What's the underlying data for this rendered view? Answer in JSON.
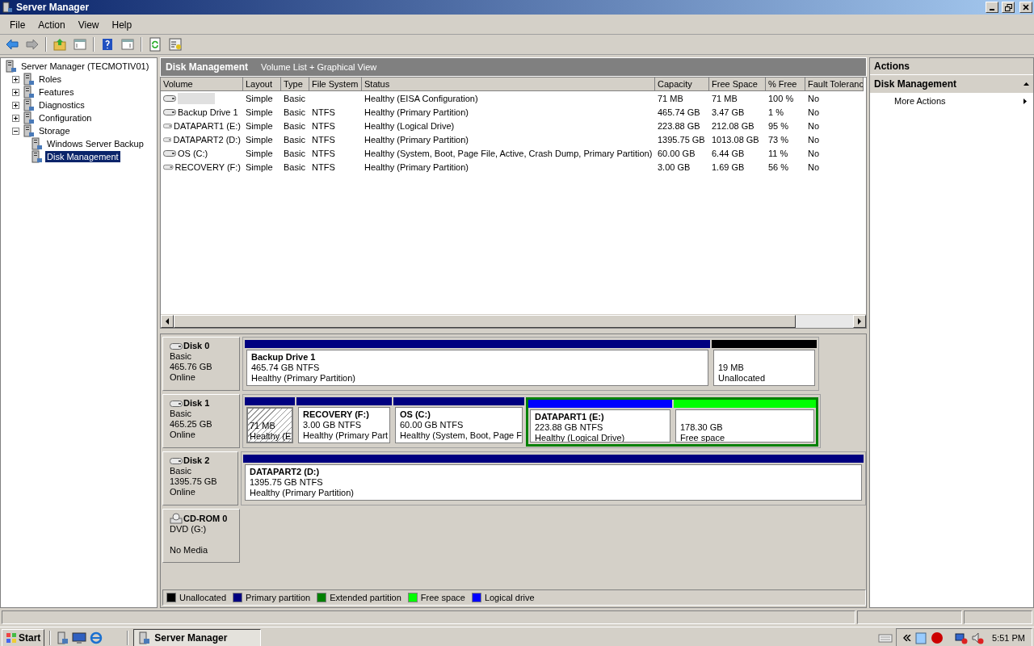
{
  "window": {
    "title": "Server Manager"
  },
  "menu": [
    "File",
    "Action",
    "View",
    "Help"
  ],
  "tree": {
    "label": "Server Manager (TECMOTIV01)",
    "selected": false,
    "children": [
      {
        "label": "Roles",
        "selected": false,
        "expanded": false
      },
      {
        "label": "Features",
        "selected": false,
        "expanded": false
      },
      {
        "label": "Diagnostics",
        "selected": false,
        "expanded": false
      },
      {
        "label": "Configuration",
        "selected": false,
        "expanded": false
      },
      {
        "label": "Storage",
        "selected": false,
        "expanded": true,
        "children": [
          {
            "label": "Windows Server Backup",
            "selected": false
          },
          {
            "label": "Disk Management",
            "selected": true
          }
        ]
      }
    ]
  },
  "center": {
    "title": "Disk Management",
    "subtitle": "Volume List + Graphical View"
  },
  "table": {
    "columns": [
      "Volume",
      "Layout",
      "Type",
      "File System",
      "Status",
      "Capacity",
      "Free Space",
      "% Free",
      "Fault Toleranc"
    ],
    "rows": [
      {
        "redacted": true,
        "cells": [
          "",
          "Simple",
          "Basic",
          "",
          "Healthy (EISA Configuration)",
          "71 MB",
          "71 MB",
          "100 %",
          "No"
        ]
      },
      {
        "cells": [
          "Backup Drive 1",
          "Simple",
          "Basic",
          "NTFS",
          "Healthy (Primary Partition)",
          "465.74 GB",
          "3.47 GB",
          "1 %",
          "No"
        ]
      },
      {
        "cells": [
          "DATAPART1 (E:)",
          "Simple",
          "Basic",
          "NTFS",
          "Healthy (Logical Drive)",
          "223.88 GB",
          "212.08 GB",
          "95 %",
          "No"
        ]
      },
      {
        "cells": [
          "DATAPART2 (D:)",
          "Simple",
          "Basic",
          "NTFS",
          "Healthy (Primary Partition)",
          "1395.75 GB",
          "1013.08 GB",
          "73 %",
          "No"
        ]
      },
      {
        "cells": [
          "OS (C:)",
          "Simple",
          "Basic",
          "NTFS",
          "Healthy (System, Boot, Page File, Active, Crash Dump, Primary Partition)",
          "60.00 GB",
          "6.44 GB",
          "11 %",
          "No"
        ]
      },
      {
        "cells": [
          "RECOVERY (F:)",
          "Simple",
          "Basic",
          "NTFS",
          "Healthy (Primary Partition)",
          "3.00 GB",
          "1.69 GB",
          "56 %",
          "No"
        ]
      }
    ]
  },
  "disks": [
    {
      "kind": "disk",
      "name": "Disk 0",
      "lines": [
        "Basic",
        "465.76 GB",
        "Online"
      ],
      "partitions": [
        {
          "kind": "primary",
          "color": "#000080",
          "name": "Backup Drive 1",
          "lines": [
            "465.74 GB NTFS",
            "Healthy (Primary Partition)"
          ]
        },
        {
          "kind": "unallocated",
          "color": "#000000",
          "lines": [
            "19 MB",
            "Unallocated"
          ]
        }
      ]
    },
    {
      "kind": "disk",
      "name": "Disk 1",
      "lines": [
        "Basic",
        "465.25 GB",
        "Online"
      ],
      "partitions": [
        {
          "kind": "hatched",
          "color": "#000080",
          "lines": [
            "71 MB",
            "Healthy (E"
          ]
        },
        {
          "kind": "primary",
          "color": "#000080",
          "name": "RECOVERY  (F:)",
          "lines": [
            "3.00 GB NTFS",
            "Healthy (Primary Part"
          ]
        },
        {
          "kind": "primary",
          "color": "#000080",
          "name": "OS  (C:)",
          "lines": [
            "60.00 GB NTFS",
            "Healthy (System, Boot, Page F"
          ]
        },
        {
          "kind": "extended",
          "color": "#008000",
          "children": [
            {
              "kind": "logical",
              "color": "#0000ff",
              "name": "DATAPART1  (E:)",
              "lines": [
                "223.88 GB NTFS",
                "Healthy (Logical Drive)"
              ]
            },
            {
              "kind": "free",
              "color": "#00ff00",
              "lines": [
                "178.30 GB",
                "Free space"
              ]
            }
          ]
        }
      ]
    },
    {
      "kind": "disk",
      "name": "Disk 2",
      "lines": [
        "Basic",
        "1395.75 GB",
        "Online"
      ],
      "partitions": [
        {
          "kind": "primary",
          "color": "#000080",
          "name": "DATAPART2  (D:)",
          "lines": [
            "1395.75 GB NTFS",
            "Healthy (Primary Partition)"
          ]
        }
      ]
    },
    {
      "kind": "cdrom",
      "name": "CD-ROM 0",
      "lines": [
        "DVD (G:)"
      ],
      "status": "No Media"
    }
  ],
  "legend": [
    {
      "label": "Unallocated",
      "color": "#000000"
    },
    {
      "label": "Primary partition",
      "color": "#000080"
    },
    {
      "label": "Extended partition",
      "color": "#008000"
    },
    {
      "label": "Free space",
      "color": "#00ff00"
    },
    {
      "label": "Logical drive",
      "color": "#0000ff"
    }
  ],
  "actions": {
    "title": "Actions",
    "section": "Disk Management",
    "items": [
      "More Actions"
    ]
  },
  "taskbar": {
    "start": "Start",
    "task": "Server Manager",
    "time": "5:51 PM"
  }
}
